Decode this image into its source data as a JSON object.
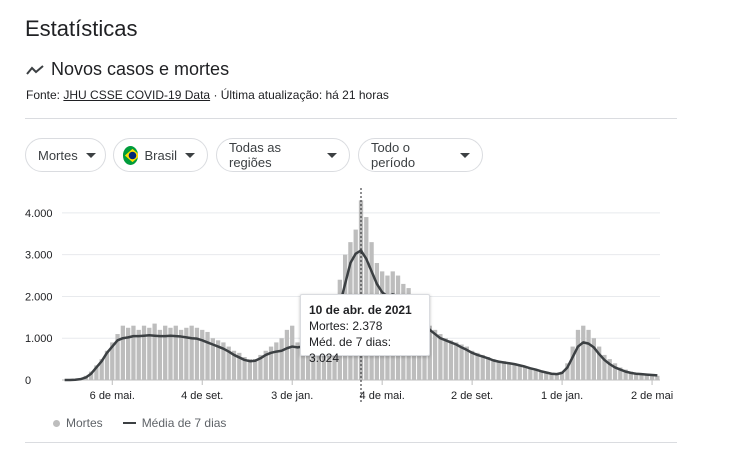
{
  "header": {
    "title": "Estatísticas",
    "subtitle": "Novos casos e mortes",
    "source_prefix": "Fonte:",
    "source_link": "JHU CSSE COVID-19 Data",
    "update_text": "· Última atualização: há 21 horas"
  },
  "filters": {
    "metric": "Mortes",
    "country": "Brasil",
    "region": "Todas as regiões",
    "period": "Todo o período"
  },
  "tooltip": {
    "date": "10 de abr. de 2021",
    "deaths": "Mortes: 2.378",
    "avg": "Méd. de 7 dias: 3.024"
  },
  "legend": {
    "bars": "Mortes",
    "line": "Média de 7 dias"
  },
  "colors": {
    "bar": "#bdbdbd",
    "line": "#3c4043",
    "grid": "#e8eaed",
    "flag_green": "#009c3b",
    "flag_yellow": "#ffdf00",
    "flag_blue": "#002776"
  },
  "chart_data": {
    "type": "bar",
    "ylim": [
      0,
      4500
    ],
    "yticks": [
      0,
      1000,
      2000,
      3000,
      4000
    ],
    "ytick_labels": [
      "0",
      "1.000",
      "2.000",
      "3.000",
      "4.000"
    ],
    "xticks": [
      {
        "label": "6 de mai.",
        "index": 9
      },
      {
        "label": "4 de set.",
        "index": 26
      },
      {
        "label": "3 de jan.",
        "index": 43
      },
      {
        "label": "4 de mai.",
        "index": 60
      },
      {
        "label": "2 de set.",
        "index": 77
      },
      {
        "label": "1 de jan.",
        "index": 94
      },
      {
        "label": "2 de mai",
        "index": 111
      }
    ],
    "marker_index": 56,
    "series": [
      {
        "name": "Mortes",
        "type": "bar",
        "values": [
          0,
          0,
          10,
          40,
          100,
          200,
          350,
          500,
          700,
          900,
          1100,
          1300,
          1250,
          1300,
          1200,
          1300,
          1250,
          1350,
          1200,
          1300,
          1250,
          1300,
          1200,
          1250,
          1300,
          1250,
          1200,
          1150,
          1000,
          950,
          900,
          800,
          700,
          650,
          550,
          500,
          500,
          600,
          700,
          800,
          900,
          1000,
          1200,
          1300,
          900,
          1000,
          1100,
          1100,
          1000,
          1100,
          1300,
          1800,
          2400,
          3000,
          3300,
          3600,
          4300,
          3900,
          3300,
          2800,
          2600,
          2500,
          2600,
          2500,
          2300,
          2200,
          2000,
          1800,
          1500,
          1300,
          1200,
          1100,
          1000,
          950,
          900,
          850,
          800,
          700,
          650,
          600,
          550,
          500,
          450,
          450,
          400,
          400,
          350,
          300,
          300,
          250,
          200,
          200,
          150,
          150,
          200,
          400,
          800,
          1200,
          1300,
          1200,
          1000,
          800,
          600,
          500,
          400,
          300,
          250,
          200,
          150,
          150,
          150,
          120,
          100
        ]
      },
      {
        "name": "Média de 7 dias",
        "type": "line",
        "values": [
          0,
          0,
          5,
          20,
          60,
          150,
          300,
          450,
          650,
          800,
          950,
          1000,
          1020,
          1050,
          1050,
          1060,
          1070,
          1060,
          1050,
          1050,
          1060,
          1050,
          1040,
          1020,
          1000,
          990,
          950,
          900,
          850,
          800,
          750,
          680,
          600,
          540,
          480,
          450,
          460,
          520,
          600,
          650,
          680,
          700,
          760,
          800,
          780,
          800,
          850,
          900,
          950,
          1000,
          1100,
          1400,
          1800,
          2300,
          2800,
          3024,
          3100,
          2900,
          2600,
          2300,
          2100,
          2000,
          2050,
          2000,
          1900,
          1800,
          1650,
          1500,
          1350,
          1200,
          1100,
          1000,
          950,
          900,
          850,
          780,
          720,
          650,
          600,
          560,
          520,
          470,
          440,
          420,
          400,
          380,
          350,
          320,
          280,
          250,
          210,
          180,
          150,
          140,
          170,
          300,
          550,
          800,
          900,
          870,
          780,
          620,
          480,
          380,
          300,
          250,
          200,
          170,
          150,
          140,
          130,
          120,
          110
        ]
      }
    ]
  }
}
